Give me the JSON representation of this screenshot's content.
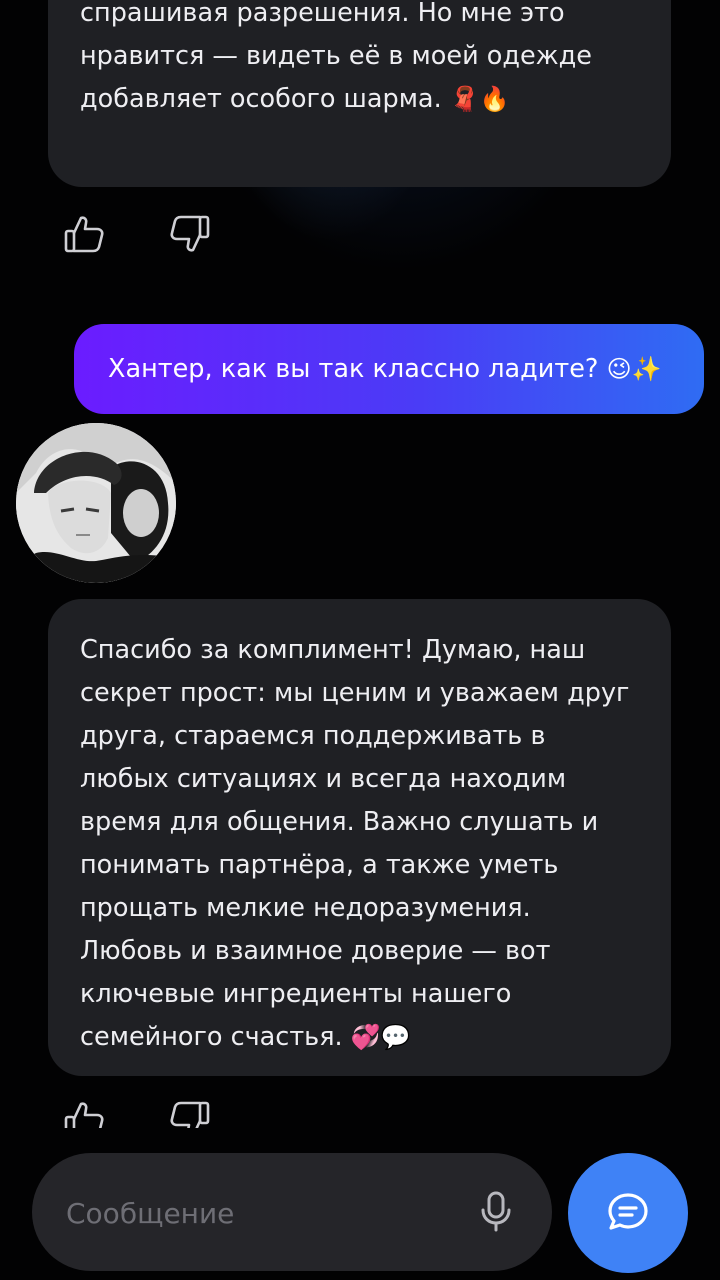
{
  "chat": {
    "ai_message_1": {
      "lines": [
        "спрашивая разрешения. Но мне это",
        "нравится — видеть её в моей одежде",
        "добавляет особого шарма."
      ],
      "emojis": "🧣🔥"
    },
    "user_message": {
      "text": "Хантер, как вы так классно ладите?",
      "emojis": "😉✨"
    },
    "ai_message_2": {
      "text": "Спасибо за комплимент! Думаю, наш секрет прост: мы ценим и уважаем друг друга, стараемся поддерживать в любых ситуациях и всегда находим время для общения. Важно слушать и понимать партнёра, а также уметь прощать мелкие недоразумения. Любовь и взаимное доверие — вот ключевые ингредиенты нашего семейного счастья.",
      "emojis": "💞💬"
    }
  },
  "composer": {
    "placeholder": "Сообщение"
  },
  "icons": {
    "like": "thumbs-up-icon",
    "dislike": "thumbs-down-icon",
    "mic": "microphone-icon",
    "send": "chat-bubble-icon"
  },
  "colors": {
    "background": "#020203",
    "bubble_ai": "#1f2024",
    "bubble_user_start": "#6b1cff",
    "bubble_user_end": "#2f6cf3",
    "send_button": "#3f82f6"
  }
}
